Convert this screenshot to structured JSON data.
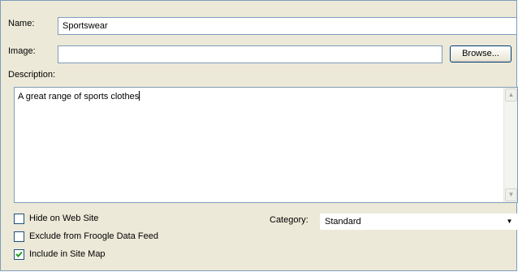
{
  "form": {
    "name_label": "Name:",
    "name_value": "Sportswear",
    "image_label": "Image:",
    "image_value": "",
    "browse_label": "Browse...",
    "description_label": "Description:",
    "description_value": "A great range of sports clothes"
  },
  "options": {
    "hide_label": "Hide on Web Site",
    "hide_checked": false,
    "exclude_label": "Exclude from Froogle Data Feed",
    "exclude_checked": false,
    "sitemap_label": "Include in Site Map",
    "sitemap_checked": true
  },
  "category": {
    "label": "Category:",
    "value": "Standard"
  },
  "icons": {
    "scroll_up": "scroll-up-arrow-icon",
    "scroll_down": "scroll-down-arrow-icon",
    "dropdown": "chevron-down-icon",
    "check": "checkmark-icon"
  },
  "colors": {
    "panel_bg": "#ece9d8",
    "field_border": "#7f9db9"
  }
}
